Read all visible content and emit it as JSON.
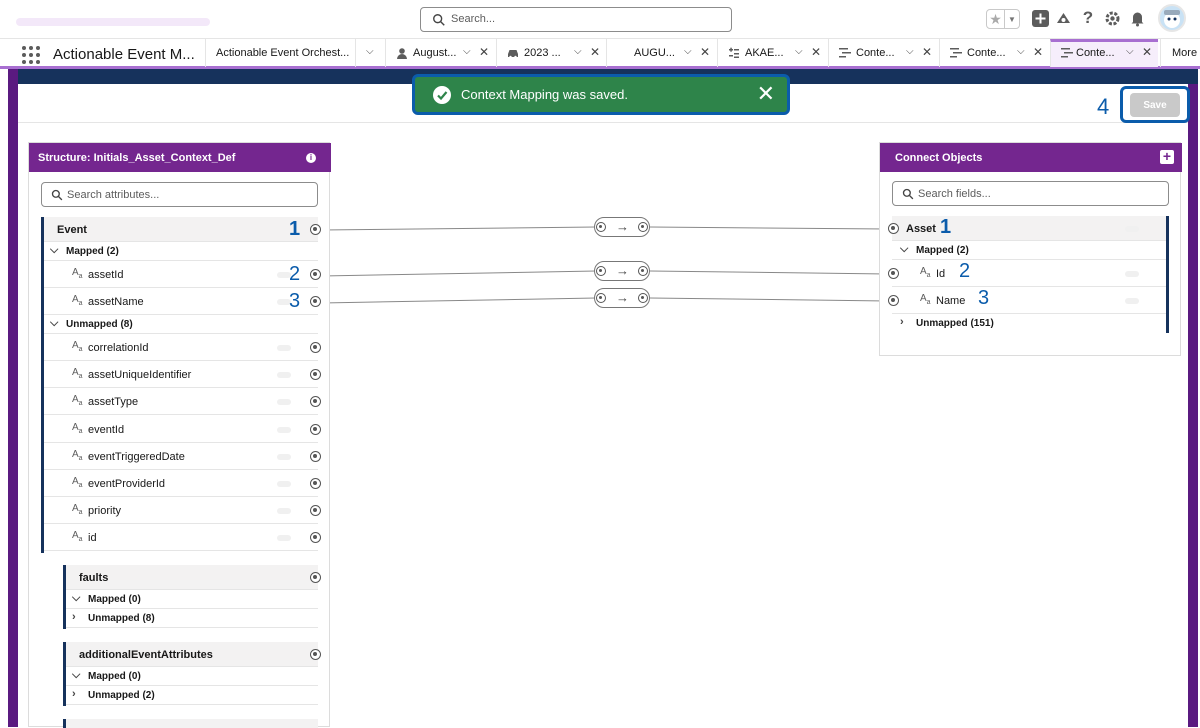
{
  "header": {
    "search_placeholder": "Search..."
  },
  "nav": {
    "app_name": "Actionable Event M...",
    "tabs": [
      {
        "label": "Actionable Event Orchest..."
      },
      {
        "label": "August..."
      },
      {
        "label": "2023 ..."
      },
      {
        "label": "AUGU..."
      },
      {
        "label": "AKAE..."
      },
      {
        "label": "Conte..."
      },
      {
        "label": "Conte..."
      },
      {
        "label": "Conte..."
      }
    ],
    "more_label": "More"
  },
  "toast": {
    "message": "Context Mapping was saved."
  },
  "save": {
    "label": "Save",
    "step": "4"
  },
  "structure_panel": {
    "title": "Structure: Initials_Asset_Context_Def",
    "search_placeholder": "Search attributes...",
    "event_label": "Event",
    "event_step": "1",
    "mapped_label": "Mapped (2)",
    "mapped_items": [
      {
        "name": "assetId",
        "step": "2"
      },
      {
        "name": "assetName",
        "step": "3"
      }
    ],
    "unmapped_label": "Unmapped (8)",
    "unmapped_items": [
      "correlationId",
      "assetUniqueIdentifier",
      "assetType",
      "eventId",
      "eventTriggeredDate",
      "eventProviderId",
      "priority",
      "id"
    ],
    "faults": {
      "label": "faults",
      "mapped": "Mapped (0)",
      "unmapped": "Unmapped (8)"
    },
    "additional": {
      "label": "additionalEventAttributes",
      "mapped": "Mapped (0)",
      "unmapped": "Unmapped (2)"
    }
  },
  "connect_panel": {
    "title": "Connect Objects",
    "search_placeholder": "Search fields...",
    "object_label": "Asset",
    "object_step": "1",
    "mapped_label": "Mapped (2)",
    "mapped_items": [
      {
        "name": "Id",
        "step": "2"
      },
      {
        "name": "Name",
        "step": "3"
      }
    ],
    "unmapped_label": "Unmapped (151)"
  },
  "type_icon": "Aa",
  "colors": {
    "brand_purple": "#74268f",
    "toast_green": "#2e844a",
    "highlight_blue": "#0b5cab",
    "navy": "#16325c"
  }
}
